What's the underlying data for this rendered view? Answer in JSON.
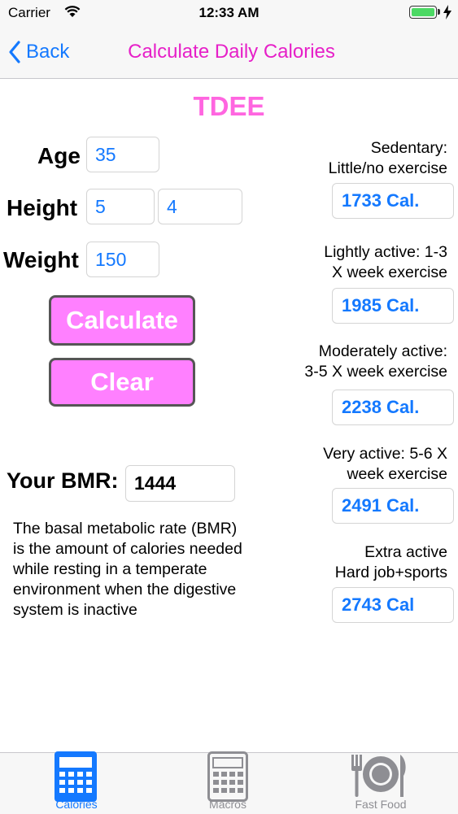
{
  "status": {
    "carrier": "Carrier",
    "time": "12:33 AM"
  },
  "nav": {
    "back_label": "Back",
    "title": "Calculate Daily Calories"
  },
  "heading": "TDEE",
  "form": {
    "age_label": "Age",
    "age_value": "35",
    "height_label": "Height",
    "height_feet": "5",
    "height_inches": "4",
    "weight_label": "Weight",
    "weight_value": "150",
    "calculate_label": "Calculate",
    "clear_label": "Clear"
  },
  "bmr": {
    "label": "Your BMR:",
    "value": "1444",
    "description": "The basal metabolic rate (BMR) is the amount of calories needed while resting in a temperate environment when the digestive system is inactive"
  },
  "levels": [
    {
      "line1": "Sedentary:",
      "line2": "Little/no exercise",
      "calories": "1733 Cal."
    },
    {
      "line1": "Lightly active: 1-3",
      "line2": "X week exercise",
      "calories": "1985 Cal."
    },
    {
      "line1": "Moderately active:",
      "line2": "3-5 X week exercise",
      "calories": "2238 Cal."
    },
    {
      "line1": "Very active: 5-6 X",
      "line2": "week exercise",
      "calories": "2491 Cal."
    },
    {
      "line1": "Extra active",
      "line2": "Hard job+sports",
      "calories": "2743 Cal"
    }
  ],
  "tabs": [
    {
      "label": "Calories",
      "icon": "calculator-icon",
      "active": true
    },
    {
      "label": "Macros",
      "icon": "calculator-outline-icon",
      "active": false
    },
    {
      "label": "Fast Food",
      "icon": "fork-plate-knife-icon",
      "active": false
    }
  ],
  "colors": {
    "accent": "#1479ff",
    "title": "#e620c8",
    "heading": "#ff66e0",
    "button": "#ff80ff",
    "battery": "#4cd964"
  }
}
